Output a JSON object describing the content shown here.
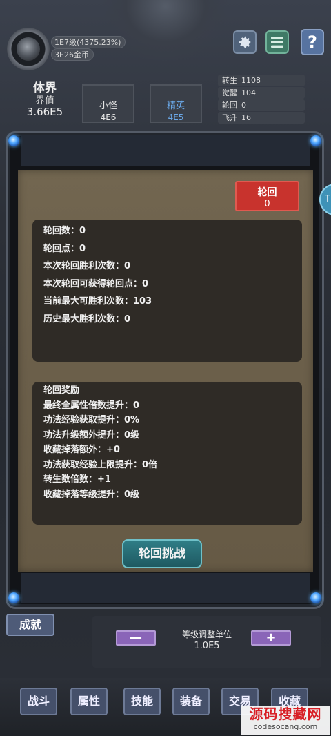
{
  "header": {
    "level_text": "1E7级(4375.23%)",
    "gold_text": "3E26金币",
    "realm_title": "体界",
    "realm_label": "界值",
    "realm_value": "3.66E5"
  },
  "toolbar": {
    "settings_icon": "gear-icon",
    "menu_icon": "menu-icon",
    "help_label": "?"
  },
  "stats": [
    {
      "label": "转生",
      "value": "1108"
    },
    {
      "label": "觉醒",
      "value": "104"
    },
    {
      "label": "轮回",
      "value": "0"
    },
    {
      "label": "飞升",
      "value": "16"
    }
  ],
  "monster_tabs": [
    {
      "name": "小怪",
      "value": "4E6",
      "color": "#d8d8d8"
    },
    {
      "name": "精英",
      "value": "4E5",
      "color": "#6aa8e8"
    }
  ],
  "reincarnation": {
    "button_title": "轮回",
    "button_value": "0",
    "info_lines": [
      "轮回数：0",
      "轮回点：0",
      "本次轮回胜利次数：0",
      "本次轮回可获得轮回点：0",
      "当前最大可胜利次数：103",
      "历史最大胜利次数：0"
    ],
    "rewards_title": "轮回奖励",
    "reward_lines": [
      "最终全属性倍数提升：0",
      "功法经验获取提升：0%",
      "功法升级额外提升：0级",
      "收藏掉落额外：+0",
      "功法获取经验上限提升：0倍",
      "转生数倍数：+1",
      "收藏掉落等级提升：0级"
    ],
    "challenge_label": "轮回挑战"
  },
  "side_tab_label": "T",
  "achievement_label": "成就",
  "adjust": {
    "minus": "—",
    "plus": "+",
    "label": "等级调整单位",
    "value": "1.0E5"
  },
  "nav": [
    "战斗",
    "属性",
    "技能",
    "装备",
    "交易",
    "收藏"
  ],
  "watermark": {
    "line1": "源码搜藏网",
    "line2": "codesocang.com"
  }
}
